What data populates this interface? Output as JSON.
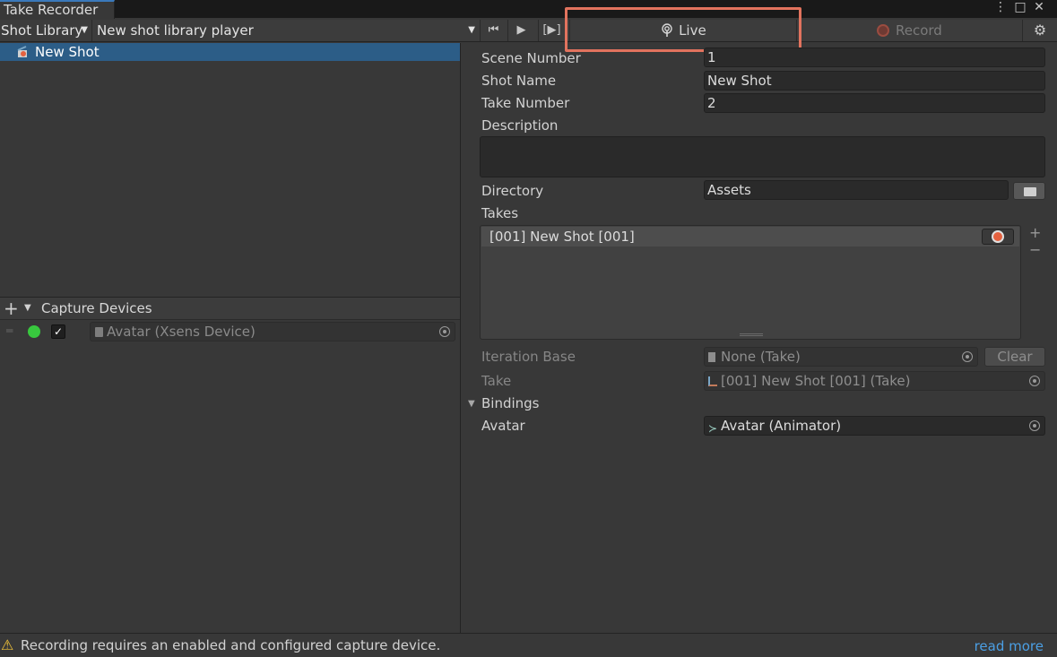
{
  "window": {
    "tab_title": "Take Recorder",
    "menu_icon": "⋮",
    "maximize_icon": "□",
    "close_icon": "✕"
  },
  "toolbar": {
    "library_dropdown": "Shot Library",
    "player": "New shot library player",
    "skip_start_icon": "⏮",
    "play_icon": "▶",
    "preview_icon": "[▶]",
    "live_label": "Live",
    "record_label": "Record",
    "settings_icon": "⚙"
  },
  "shots": [
    {
      "name": "New Shot"
    }
  ],
  "capture": {
    "header": "Capture Devices",
    "devices": [
      {
        "name": "Avatar (Xsens Device)",
        "enabled": true
      }
    ]
  },
  "inspector": {
    "scene_number_label": "Scene Number",
    "scene_number": "1",
    "shot_name_label": "Shot Name",
    "shot_name": "New Shot",
    "take_number_label": "Take Number",
    "take_number": "2",
    "description_label": "Description",
    "directory_label": "Directory",
    "directory": "Assets",
    "takes_label": "Takes",
    "takes": [
      "[001] New Shot [001]"
    ],
    "iteration_base_label": "Iteration Base",
    "iteration_base": "None (Take)",
    "clear_label": "Clear",
    "take_label": "Take",
    "take_value": "[001] New Shot [001] (Take)",
    "bindings_label": "Bindings",
    "avatar_label": "Avatar",
    "avatar_value": "Avatar (Animator)"
  },
  "status": {
    "message": "Recording requires an enabled and configured capture device.",
    "link": "read more"
  }
}
